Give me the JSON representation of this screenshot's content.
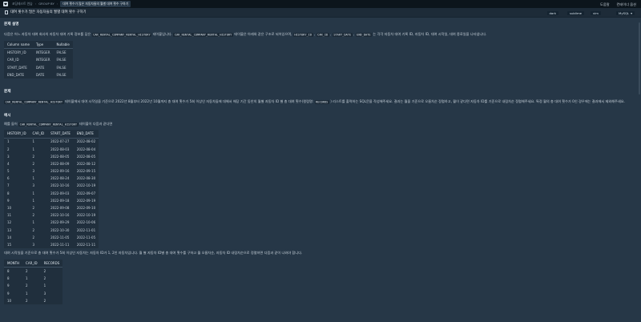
{
  "nav": {
    "crumbs": [
      "코딩테스트 연습",
      "GROUP BY"
    ],
    "active": "대여 횟수가 많은 자동차들의 월별 대여 횟수 구하기"
  },
  "header": {
    "title": "대여 횟수가 많은 자동차들의 월별 대여 횟수 구하기",
    "help": "도움말",
    "keys": "컨테이너 옵션"
  },
  "toolbar": {
    "themes": [
      "dark",
      "sublime",
      "vim"
    ],
    "language": "MySQL"
  },
  "description": {
    "title": "문제 설명",
    "p1": [
      "다음은 어느 자동차 대여 회사의 자동차 대여 기록 정보를 담은 ",
      "CAR_RENTAL_COMPANY_RENTAL_HISTORY",
      " 테이블입니다. ",
      "CAR_RENTAL_COMPANY_RENTAL_HISTORY",
      " 테이블은 아래와 같은 구조로 되어있으며, ",
      "HISTORY_ID",
      " , ",
      "CAR_ID",
      " , ",
      "START_DATE",
      " , ",
      "END_DATE",
      " 는 각각 자동차 대여 기록 ID, 자동차 ID, 대여 시작일, 대여 종료일을 나타냅니다."
    ],
    "schema": {
      "headers": [
        "Column name",
        "Type",
        "Nullable"
      ],
      "rows": [
        [
          "HISTORY_ID",
          "INTEGER",
          "FALSE"
        ],
        [
          "CAR_ID",
          "INTEGER",
          "FALSE"
        ],
        [
          "START_DATE",
          "DATE",
          "FALSE"
        ],
        [
          "END_DATE",
          "DATE",
          "FALSE"
        ]
      ]
    }
  },
  "problem": {
    "title": "문제",
    "p1": [
      "CAR_RENTAL_COMPANY_RENTAL_HISTORY",
      " 테이블에서 대여 시작일을 기준으로 2022년 8월부터 2022년 10월까지 총 대여 횟수가 5회 이상인 자동차들에 대해서 해당 기간 동안의 월별 자동차 ID 별 총 대여 횟수(컬럼명: ",
      "RECORDS",
      " ) 리스트를 출력하는 SQL문을 작성해주세요. 결과는 월을 기준으로 오름차순 정렬하고, 월이 같다면 자동차 ID를 기준으로 내림차순 정렬해주세요. 특정 월의 총 대여 횟수가 0인 경우에는 결과에서 제외해주세요."
    ]
  },
  "example": {
    "title": "예시",
    "p1": [
      "예를 들어 ",
      "CAR_RENTAL_COMPANY_RENTAL_HISTORY",
      " 테이블이 다음과 같다면"
    ],
    "history": {
      "headers": [
        "HISTORY_ID",
        "CAR_ID",
        "START_DATE",
        "END_DATE"
      ],
      "rows": [
        [
          "1",
          "1",
          "2022-07-27",
          "2022-08-02"
        ],
        [
          "2",
          "1",
          "2022-08-03",
          "2022-08-04"
        ],
        [
          "3",
          "2",
          "2022-08-05",
          "2022-08-05"
        ],
        [
          "4",
          "2",
          "2022-08-09",
          "2022-08-12"
        ],
        [
          "5",
          "3",
          "2022-09-16",
          "2022-09-15"
        ],
        [
          "6",
          "1",
          "2022-08-24",
          "2022-08-30"
        ],
        [
          "7",
          "3",
          "2022-10-16",
          "2022-10-19"
        ],
        [
          "8",
          "1",
          "2022-09-03",
          "2022-09-07"
        ],
        [
          "9",
          "1",
          "2022-09-18",
          "2022-09-19"
        ],
        [
          "10",
          "2",
          "2022-09-08",
          "2022-09-10"
        ],
        [
          "11",
          "2",
          "2022-10-16",
          "2022-10-19"
        ],
        [
          "12",
          "1",
          "2022-09-29",
          "2022-10-06"
        ],
        [
          "13",
          "2",
          "2022-10-30",
          "2022-11-01"
        ],
        [
          "14",
          "2",
          "2022-11-05",
          "2022-11-05"
        ],
        [
          "15",
          "3",
          "2022-11-11",
          "2022-11-11"
        ]
      ]
    },
    "p2": "대여 시작일을 기준으로 총 대여 횟수가 5회 이상인 자동차는 자동차 ID가 1, 2인 자동차입니다. 월 별 자동차 ID별 총 대여 횟수를 구하고 월 오름차순, 자동차 ID 내림차순으로 정렬하면 다음과 같이 나와야 합니다.",
    "result": {
      "headers": [
        "MONTH",
        "CAR_ID",
        "RECORDS"
      ],
      "rows": [
        [
          "8",
          "2",
          "2"
        ],
        [
          "8",
          "1",
          "2"
        ],
        [
          "9",
          "2",
          "1"
        ],
        [
          "9",
          "1",
          "3"
        ],
        [
          "10",
          "2",
          "2"
        ]
      ]
    }
  }
}
